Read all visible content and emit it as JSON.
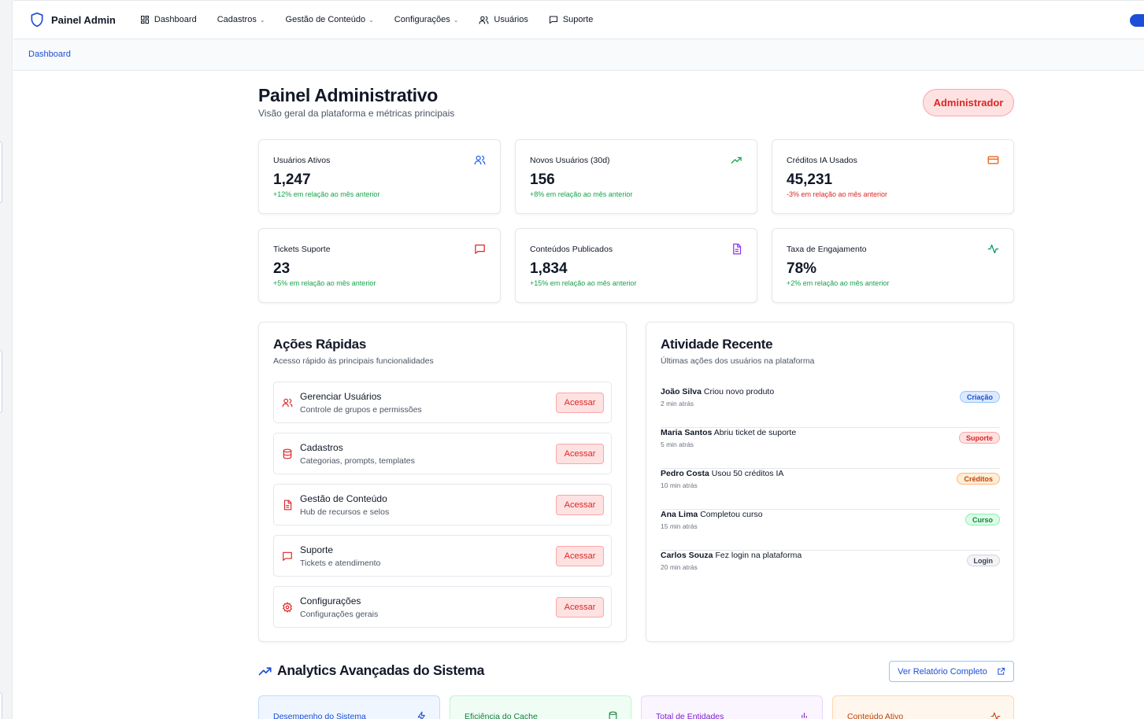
{
  "nav": {
    "brand": "Painel Admin",
    "items": [
      {
        "label": "Dashboard",
        "icon": "dashboard-icon"
      },
      {
        "label": "Cadastros",
        "dropdown": true
      },
      {
        "label": "Gestão de Conteúdo",
        "dropdown": true
      },
      {
        "label": "Configurações",
        "dropdown": true
      },
      {
        "label": "Usuários",
        "icon": "users-icon"
      },
      {
        "label": "Suporte",
        "icon": "message-icon"
      }
    ]
  },
  "breadcrumb": "Dashboard",
  "header": {
    "title": "Painel Administrativo",
    "subtitle": "Visão geral da plataforma e métricas principais",
    "role": "Administrador"
  },
  "stats": [
    {
      "label": "Usuários Ativos",
      "value": "1,247",
      "change": "+12% em relação ao mês anterior",
      "positive": true,
      "icon": "users-icon",
      "color": "#2563eb"
    },
    {
      "label": "Novos Usuários (30d)",
      "value": "156",
      "change": "+8% em relação ao mês anterior",
      "positive": true,
      "icon": "trending-up-icon",
      "color": "#16a34a"
    },
    {
      "label": "Créditos IA Usados",
      "value": "45,231",
      "change": "-3% em relação ao mês anterior",
      "positive": false,
      "icon": "credit-card-icon",
      "color": "#ea580c"
    },
    {
      "label": "Tickets Suporte",
      "value": "23",
      "change": "+5% em relação ao mês anterior",
      "positive": true,
      "icon": "message-icon",
      "color": "#dc2626"
    },
    {
      "label": "Conteúdos Publicados",
      "value": "1,834",
      "change": "+15% em relação ao mês anterior",
      "positive": true,
      "icon": "file-icon",
      "color": "#9333ea"
    },
    {
      "label": "Taxa de Engajamento",
      "value": "78%",
      "change": "+2% em relação ao mês anterior",
      "positive": true,
      "icon": "activity-icon",
      "color": "#059669"
    }
  ],
  "quick_actions": {
    "title": "Ações Rápidas",
    "subtitle": "Acesso rápido às principais funcionalidades",
    "items": [
      {
        "title": "Gerenciar Usuários",
        "desc": "Controle de grupos e permissões",
        "button": "Acessar",
        "icon": "users-icon"
      },
      {
        "title": "Cadastros",
        "desc": "Categorias, prompts, templates",
        "button": "Acessar",
        "icon": "database-icon"
      },
      {
        "title": "Gestão de Conteúdo",
        "desc": "Hub de recursos e selos",
        "button": "Acessar",
        "icon": "file-icon"
      },
      {
        "title": "Suporte",
        "desc": "Tickets e atendimento",
        "button": "Acessar",
        "icon": "message-icon"
      },
      {
        "title": "Configurações",
        "desc": "Configurações gerais",
        "button": "Acessar",
        "icon": "gear-icon"
      }
    ]
  },
  "recent_activity": {
    "title": "Atividade Recente",
    "subtitle": "Últimas ações dos usuários na plataforma",
    "items": [
      {
        "user": "João Silva",
        "action": "Criou novo produto",
        "time": "2 min atrás",
        "tag": "Criação",
        "tag_color": "#1d4ed8",
        "tag_bg": "#dbeafe",
        "tag_border": "#93c5fd"
      },
      {
        "user": "Maria Santos",
        "action": "Abriu ticket de suporte",
        "time": "5 min atrás",
        "tag": "Suporte",
        "tag_color": "#dc2626",
        "tag_bg": "#fee2e2",
        "tag_border": "#fca5a5"
      },
      {
        "user": "Pedro Costa",
        "action": "Usou 50 créditos IA",
        "time": "10 min atrás",
        "tag": "Créditos",
        "tag_color": "#c2410c",
        "tag_bg": "#ffedd5",
        "tag_border": "#fdba74"
      },
      {
        "user": "Ana Lima",
        "action": "Completou curso",
        "time": "15 min atrás",
        "tag": "Curso",
        "tag_color": "#15803d",
        "tag_bg": "#dcfce7",
        "tag_border": "#86efac"
      },
      {
        "user": "Carlos Souza",
        "action": "Fez login na plataforma",
        "time": "20 min atrás",
        "tag": "Login",
        "tag_color": "#374151",
        "tag_bg": "#f3f4f6",
        "tag_border": "#d1d5db"
      }
    ]
  },
  "analytics": {
    "title": "Analytics Avançadas do Sistema",
    "report_button": "Ver Relatório Completo",
    "cards": [
      {
        "label": "Desempenho do Sistema",
        "icon": "zap-icon",
        "color": "#1d4ed8",
        "bg": "#eff6ff",
        "border": "#bfdbfe"
      },
      {
        "label": "Eficiência do Cache",
        "icon": "database-icon",
        "color": "#15803d",
        "bg": "#f0fdf4",
        "border": "#bbf7d0"
      },
      {
        "label": "Total de Entidades",
        "icon": "bar-chart-icon",
        "color": "#7e22ce",
        "bg": "#faf5ff",
        "border": "#e9d5ff"
      },
      {
        "label": "Conteúdo Ativo",
        "icon": "activity-icon",
        "color": "#c2410c",
        "bg": "#fff7ed",
        "border": "#fed7aa"
      }
    ]
  }
}
